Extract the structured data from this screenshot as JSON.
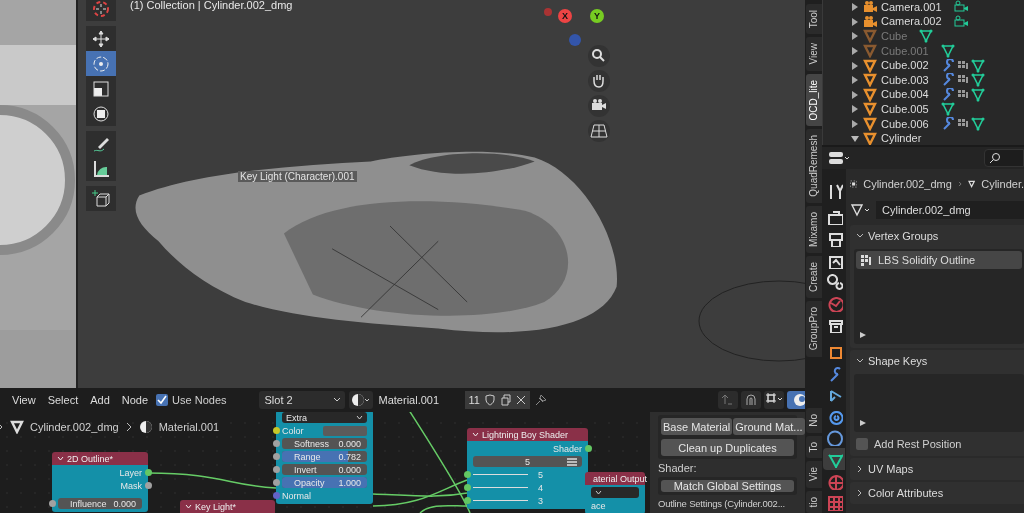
{
  "viewport": {
    "header_text": "(1) Collection | Cylinder.002_dmg",
    "tools": [
      {
        "kind": "cursor",
        "selected": false
      },
      {
        "kind": "move",
        "selected": false
      },
      {
        "kind": "rotate",
        "selected": true
      },
      {
        "kind": "scale",
        "selected": false
      },
      {
        "kind": "transform",
        "selected": false
      },
      {
        "kind": "annotate",
        "selected": false
      },
      {
        "kind": "measure",
        "selected": false
      },
      {
        "kind": "add-cube",
        "selected": false
      }
    ],
    "gizmo": {
      "x_label": "X",
      "y_label": "Y"
    },
    "overlay_label": "Key Light (Character).001",
    "tabs": [
      {
        "label": "Tool",
        "selected": false
      },
      {
        "label": "View",
        "selected": false
      },
      {
        "label": "OCD_lite",
        "selected": true
      },
      {
        "label": "QuadRemesh",
        "selected": false
      },
      {
        "label": "Mixamo",
        "selected": false
      },
      {
        "label": "Create",
        "selected": false
      },
      {
        "label": "GroupPro",
        "selected": false
      }
    ]
  },
  "outliner": {
    "items": [
      {
        "name": "Camera.001",
        "kind": "camera",
        "disabled": false,
        "modifiers": false,
        "expanded": false
      },
      {
        "name": "Camera.002",
        "kind": "camera",
        "disabled": false,
        "modifiers": false,
        "expanded": false
      },
      {
        "name": "Cube",
        "kind": "mesh",
        "disabled": true,
        "modifiers": false,
        "expanded": false
      },
      {
        "name": "Cube.001",
        "kind": "mesh",
        "disabled": true,
        "modifiers": false,
        "expanded": false
      },
      {
        "name": "Cube.002",
        "kind": "mesh",
        "disabled": false,
        "modifiers": true,
        "expanded": false
      },
      {
        "name": "Cube.003",
        "kind": "mesh",
        "disabled": false,
        "modifiers": true,
        "expanded": false
      },
      {
        "name": "Cube.004",
        "kind": "mesh",
        "disabled": false,
        "modifiers": true,
        "expanded": false
      },
      {
        "name": "Cube.005",
        "kind": "mesh",
        "disabled": false,
        "modifiers": false,
        "expanded": false
      },
      {
        "name": "Cube.006",
        "kind": "mesh",
        "disabled": false,
        "modifiers": true,
        "expanded": false
      },
      {
        "name": "Cylinder",
        "kind": "mesh",
        "disabled": false,
        "modifiers": false,
        "expanded": true
      }
    ]
  },
  "properties": {
    "breadcrumb": [
      "Cylinder.002_dmg",
      "Cylinder."
    ],
    "mesh_name": "Cylinder.002_dmg",
    "tabs": [
      {
        "kind": "tool",
        "selected": false
      },
      {
        "kind": "render",
        "selected": false
      },
      {
        "kind": "output",
        "selected": false
      },
      {
        "kind": "view-layer",
        "selected": false
      },
      {
        "kind": "scene",
        "selected": false
      },
      {
        "kind": "world",
        "selected": false
      },
      {
        "kind": "collection",
        "selected": false
      },
      {
        "kind": "object",
        "selected": false
      },
      {
        "kind": "modifier",
        "selected": false
      },
      {
        "kind": "particles",
        "selected": false
      },
      {
        "kind": "physics",
        "selected": false
      },
      {
        "kind": "constraints",
        "selected": false
      },
      {
        "kind": "data",
        "selected": true
      },
      {
        "kind": "material",
        "selected": false
      },
      {
        "kind": "texture",
        "selected": false
      }
    ],
    "panels": [
      {
        "title": "Vertex Groups",
        "expanded": true,
        "items": [
          "LBS Solidify Outline"
        ]
      },
      {
        "title": "Shape Keys",
        "expanded": true,
        "checkbox": {
          "label": "Add Rest Position",
          "checked": false
        }
      },
      {
        "title": "UV Maps",
        "expanded": false
      },
      {
        "title": "Color Attributes",
        "expanded": false
      }
    ]
  },
  "node_editor": {
    "menus": [
      "View",
      "Select",
      "Add",
      "Node"
    ],
    "use_nodes": {
      "label": "Use Nodes",
      "checked": true
    },
    "slot": "Slot 2",
    "material": "Material.001",
    "users": "11",
    "breadcrumb": [
      "Cylinder.002_dmg",
      "Material.001"
    ],
    "nodes": [
      {
        "title": "2D Outline*",
        "rows": [
          {
            "kind": "output",
            "label": "Layer",
            "color": "#63c763"
          },
          {
            "kind": "output",
            "label": "Mask",
            "color": "#a1a1a1"
          },
          {
            "kind": "spacer"
          },
          {
            "kind": "value",
            "label": "Influence",
            "value": "0.000",
            "color": "#a1a1a1"
          }
        ]
      },
      {
        "title": "Key Light*"
      },
      {
        "rows": [
          {
            "kind": "dropdown",
            "label": "Extra"
          },
          {
            "kind": "color",
            "label": "Color",
            "color": "#c7c729"
          },
          {
            "kind": "value",
            "label": "Softness",
            "value": "0.000",
            "color": "#a1a1a1"
          },
          {
            "kind": "slider",
            "label": "Range",
            "value": "0.782",
            "level": 0.782,
            "color": "#a1a1a1"
          },
          {
            "kind": "value",
            "label": "Invert",
            "value": "0.000",
            "color": "#a1a1a1"
          },
          {
            "kind": "slider",
            "label": "Opacity",
            "value": "1.000",
            "level": 1,
            "color": "#a1a1a1"
          },
          {
            "kind": "input",
            "label": "Normal",
            "color": "#6363c7"
          }
        ]
      },
      {
        "title": "Lightning Boy Shader",
        "rows": [
          {
            "kind": "output",
            "label": "Shader",
            "color": "#63c763"
          },
          {
            "kind": "menu-field",
            "value": "5"
          },
          {
            "kind": "line-input",
            "label": "5",
            "color": "#63c763"
          },
          {
            "kind": "line-input",
            "label": "4",
            "color": "#63c763"
          },
          {
            "kind": "line-input",
            "label": "3",
            "color": "#63c763"
          }
        ]
      },
      {
        "title": "aterial Output",
        "rows": [
          {
            "kind": "dropdown"
          },
          {
            "kind": "plain",
            "label": "ace"
          }
        ]
      }
    ],
    "sidebar": {
      "buttons": [
        [
          "Base Material",
          "Ground Mat..."
        ],
        [
          "Clean up Duplicates"
        ]
      ],
      "shader_label": "Shader:",
      "match_button": "Match Global Settings",
      "outline_label": "Outline Settings (Cylinder.002..."
    },
    "tabs": [
      {
        "label": "No",
        "selected": false
      },
      {
        "label": "To",
        "selected": false
      },
      {
        "label": "Vie",
        "selected": false
      },
      {
        "label": "tio",
        "selected": false
      }
    ]
  }
}
